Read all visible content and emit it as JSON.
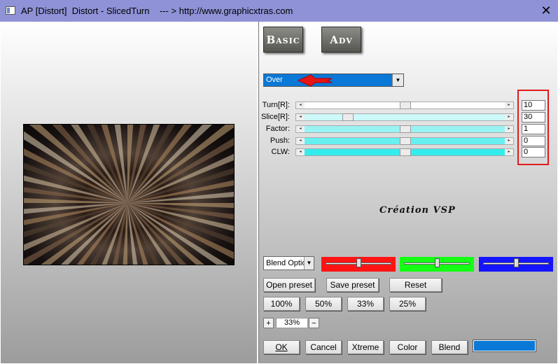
{
  "window": {
    "title": "AP [Distort]  Distort - SlicedTurn    --- > http://www.graphicxtras.com",
    "close_label": "✕"
  },
  "tabs": {
    "basic_label": "Basic",
    "adv_label": "Adv"
  },
  "mode": {
    "selected": "Over"
  },
  "params": [
    {
      "label": "Turn[R]:",
      "value": "10",
      "level": 0.5,
      "track_color": "#ffffff"
    },
    {
      "label": "Slice[R]:",
      "value": "30",
      "level": 0.2,
      "track_color": "#ccf9f9"
    },
    {
      "label": "Factor:",
      "value": "1",
      "level": 0.5,
      "track_color": "#99f3f3"
    },
    {
      "label": "Push:",
      "value": "0",
      "level": 0.5,
      "track_color": "#66f0f0"
    },
    {
      "label": "CLW:",
      "value": "0",
      "level": 0.5,
      "track_color": "#33ecec"
    }
  ],
  "credit_text": "Création VSP",
  "blend": {
    "selected": "Blend Optio",
    "red": {
      "color": "#ff1414",
      "level": 0.5
    },
    "green": {
      "color": "#14ff14",
      "level": 0.5
    },
    "blue": {
      "color": "#1414ff",
      "level": 0.5
    }
  },
  "presets": {
    "open_label": "Open preset",
    "save_label": "Save preset",
    "reset_label": "Reset"
  },
  "zoom_buttons": [
    "100%",
    "50%",
    "33%",
    "25%"
  ],
  "zoom": {
    "plus_label": "+",
    "minus_label": "−",
    "value": "33%"
  },
  "footer": {
    "ok_label": "OK",
    "cancel_label": "Cancel",
    "xtreme_label": "Xtreme",
    "color_label": "Color",
    "blend_label": "Blend",
    "blend_color": "#0a78d7"
  }
}
